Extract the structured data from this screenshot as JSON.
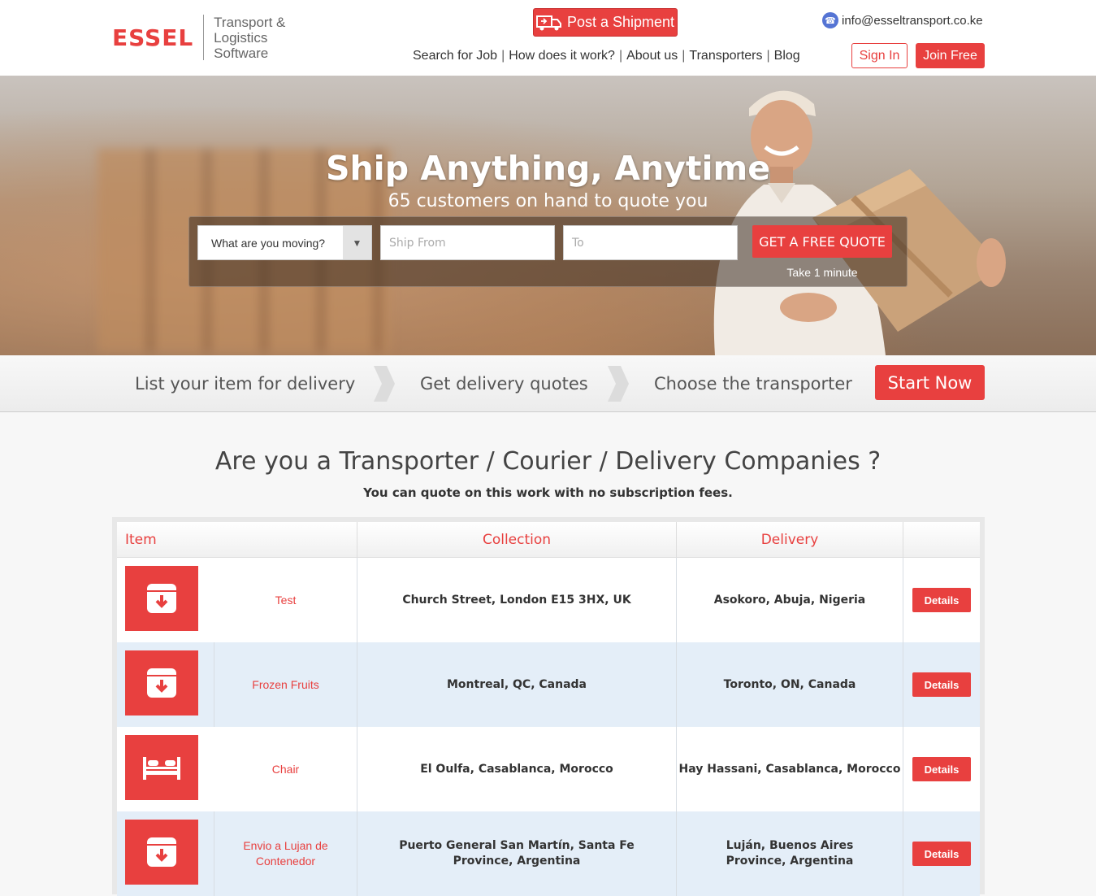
{
  "header": {
    "logo_main": "ESSEL",
    "logo_sub": "Transport & Logistics Software",
    "post_label": "Post a Shipment",
    "email": "info@esseltransport.co.ke",
    "signin_label": "Sign In",
    "join_label": "Join Free",
    "nav": [
      {
        "label": "Search for Job"
      },
      {
        "label": "How does it work?"
      },
      {
        "label": "About us"
      },
      {
        "label": "Transporters"
      },
      {
        "label": "Blog"
      }
    ]
  },
  "hero": {
    "title": "Ship Anything, Anytime",
    "subtitle": "65 customers on hand to quote you",
    "select_label": "What are you moving?",
    "from_placeholder": "Ship From",
    "to_placeholder": "To",
    "quote_button": "GET A FREE QUOTE",
    "quote_note": "Take 1 minute"
  },
  "steps": {
    "step1": "List your item for delivery",
    "step2": "Get delivery quotes",
    "step3": "Choose the transporter",
    "start_label": "Start Now"
  },
  "main": {
    "title": "Are you a Transporter / Courier / Delivery Companies ?",
    "subtitle": "You can quote on this work with no subscription fees."
  },
  "table": {
    "headers": {
      "item": "Item",
      "collection": "Collection",
      "delivery": "Delivery"
    },
    "rows": [
      {
        "icon": "box-down-icon",
        "name": "Test",
        "collection": "Church Street, London E15 3HX, UK",
        "delivery": "Asokoro, Abuja, Nigeria",
        "action": "Details"
      },
      {
        "icon": "box-down-icon",
        "name": "Frozen Fruits",
        "collection": "Montreal, QC, Canada",
        "delivery": "Toronto, ON, Canada",
        "action": "Details"
      },
      {
        "icon": "bed-icon",
        "name": "Chair",
        "collection": "El Oulfa, Casablanca, Morocco",
        "delivery": "Hay Hassani, Casablanca, Morocco",
        "action": "Details"
      },
      {
        "icon": "box-down-icon",
        "name": "Envio a Lujan de Contenedor",
        "collection": "Puerto General San Martín, Santa Fe Province, Argentina",
        "delivery": "Luján, Buenos Aires Province, Argentina",
        "action": "Details"
      }
    ]
  },
  "colors": {
    "accent": "#e8403f",
    "row_alt": "#e4eef8"
  }
}
